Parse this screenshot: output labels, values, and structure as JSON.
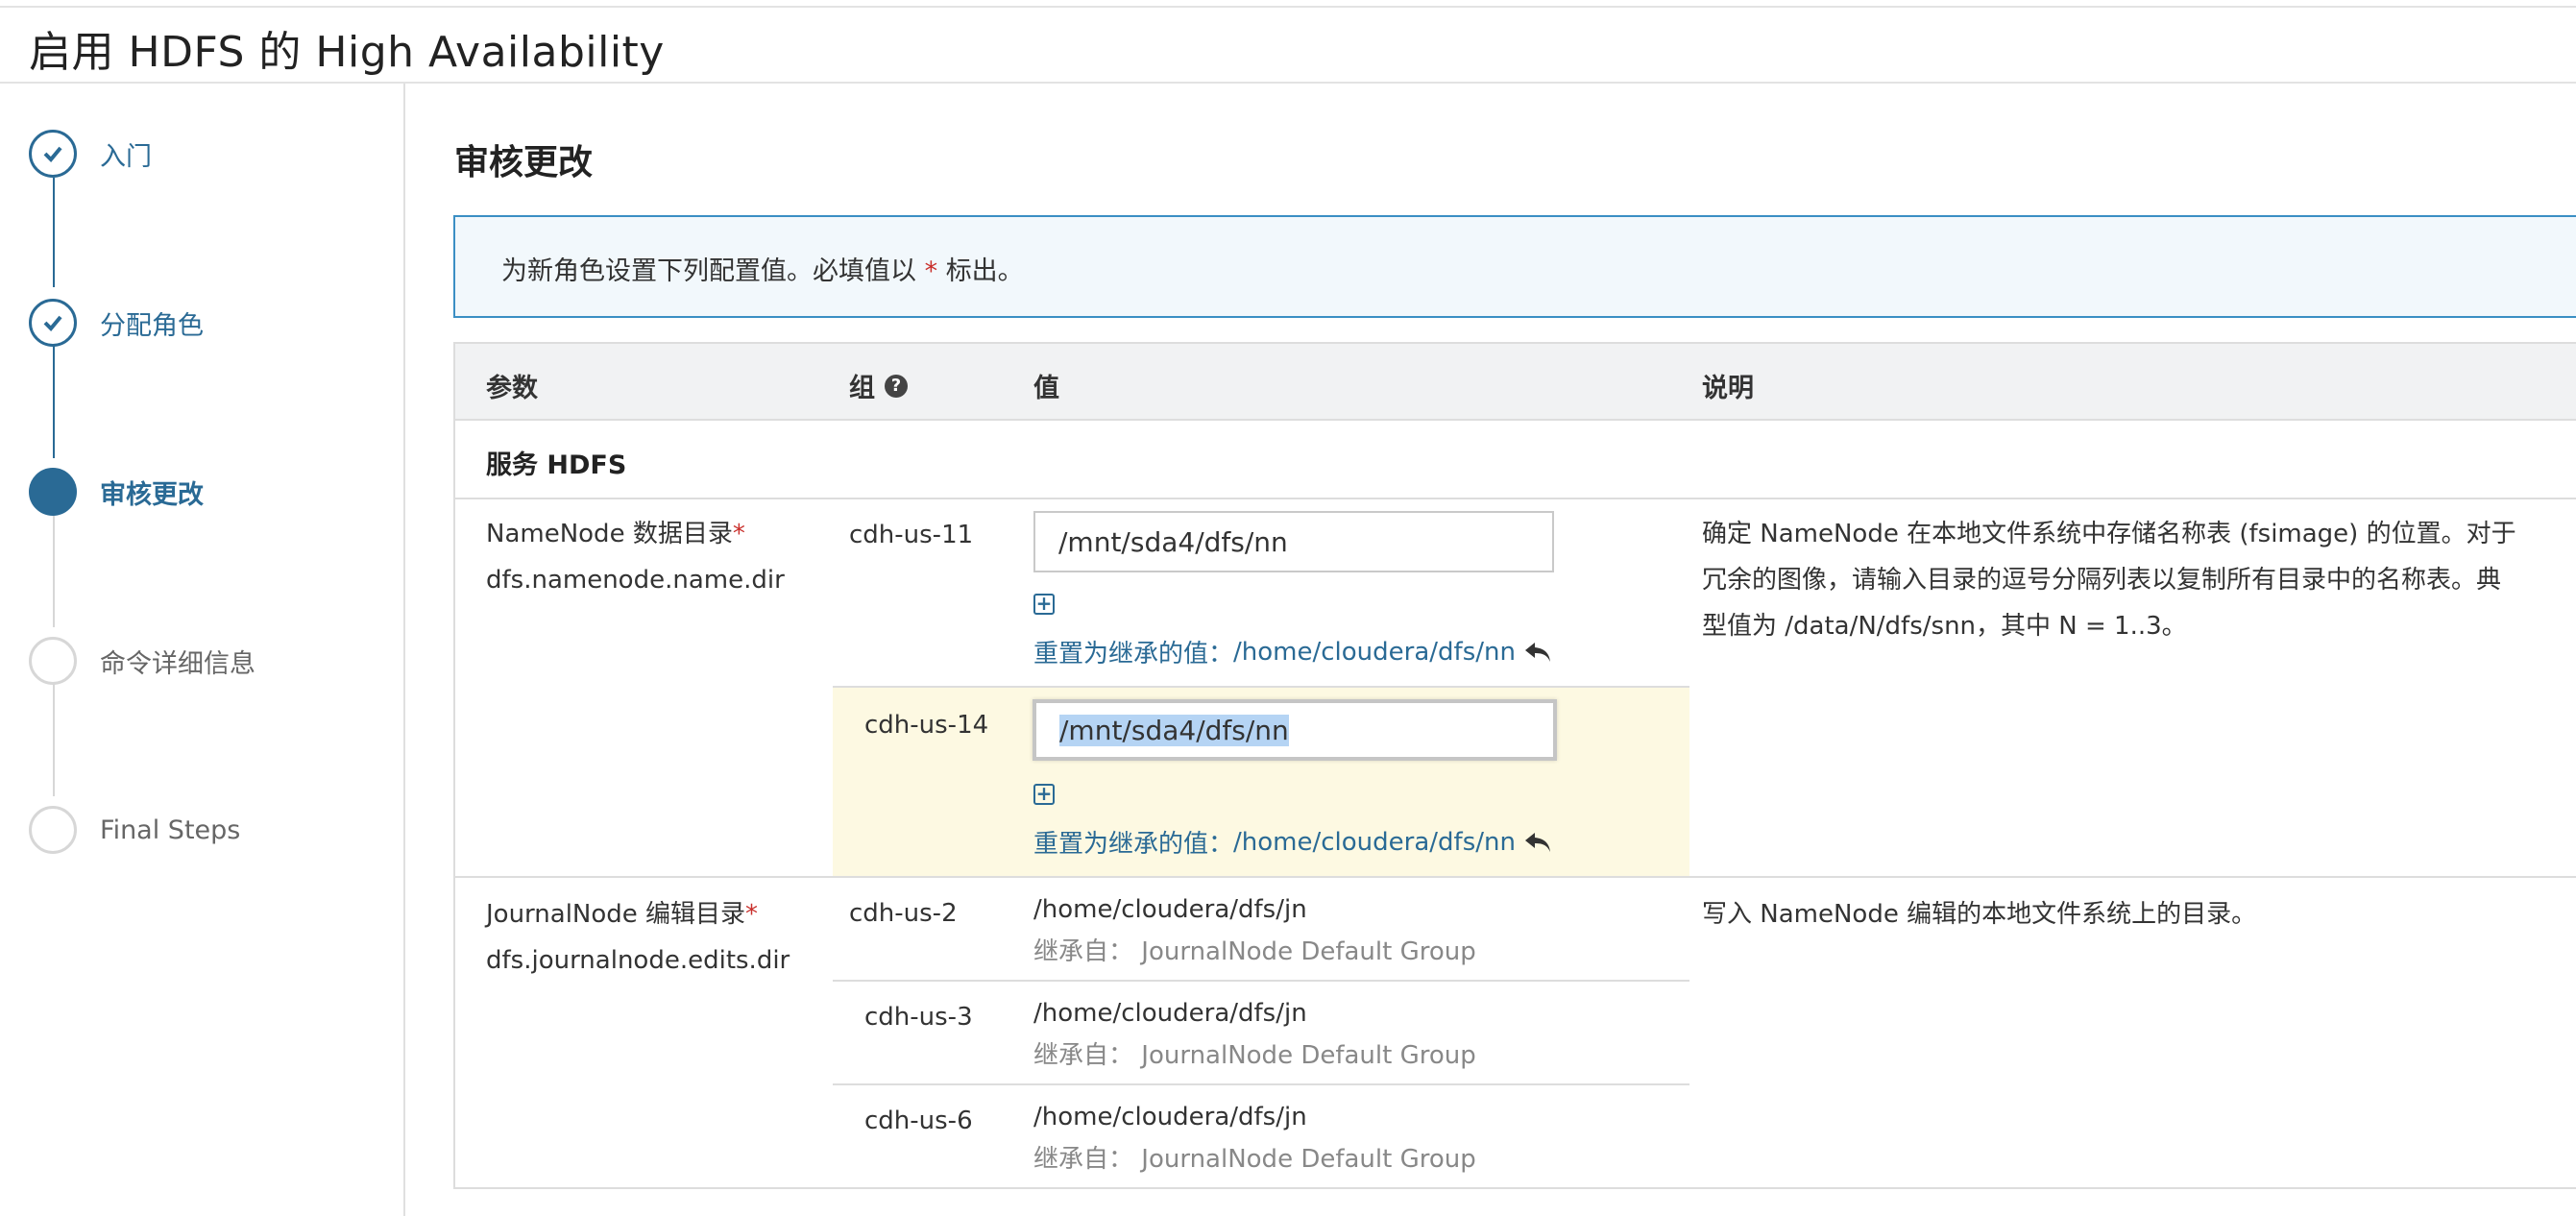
{
  "page": {
    "title": "启用 HDFS 的 High Availability"
  },
  "wizard": {
    "steps": [
      {
        "label": "入门",
        "state": "done"
      },
      {
        "label": "分配角色",
        "state": "done"
      },
      {
        "label": "审核更改",
        "state": "current"
      },
      {
        "label": "命令详细信息",
        "state": "pending"
      },
      {
        "label": "Final Steps",
        "state": "pending"
      }
    ]
  },
  "main": {
    "section_title": "审核更改",
    "info": {
      "text_before": "为新角色设置下列配置值。必填值以",
      "required_mark": "*",
      "text_after": "标出。"
    },
    "table": {
      "headers": {
        "param": "参数",
        "group": "组",
        "value": "值",
        "desc": "说明"
      },
      "service_group": "服务 HDFS",
      "namenode": {
        "label": "NameNode 数据目录",
        "required_mark": "*",
        "key": "dfs.namenode.name.dir",
        "description": [
          "确定 NameNode 在本地文件系统中存储名称表 (fsimage) 的位置。对于",
          "冗余的图像，请输入目录的逗号分隔列表以复制所有目录中的名称表。典",
          "型值为 /data/N/dfs/snn，其中 N = 1..3。"
        ],
        "rows": [
          {
            "host": "cdh-us-11",
            "value": "/mnt/sda4/dfs/nn",
            "reset_label": "重置为继承的值：",
            "reset_value": "/home/cloudera/dfs/nn"
          },
          {
            "host": "cdh-us-14",
            "value": "/mnt/sda4/dfs/nn",
            "reset_label": "重置为继承的值：",
            "reset_value": "/home/cloudera/dfs/nn"
          }
        ]
      },
      "journalnode": {
        "label": "JournalNode 编辑目录",
        "required_mark": "*",
        "key": "dfs.journalnode.edits.dir",
        "description": "写入 NameNode 编辑的本地文件系统上的目录。",
        "rows": [
          {
            "host": "cdh-us-2",
            "value": "/home/cloudera/dfs/jn",
            "inherit_label": "继承自：",
            "inherit_value": "JournalNode Default Group"
          },
          {
            "host": "cdh-us-3",
            "value": "/home/cloudera/dfs/jn",
            "inherit_label": "继承自：",
            "inherit_value": "JournalNode Default Group"
          },
          {
            "host": "cdh-us-6",
            "value": "/home/cloudera/dfs/jn",
            "inherit_label": "继承自：",
            "inherit_value": "JournalNode Default Group"
          }
        ]
      }
    }
  },
  "colors": {
    "accent": "#2a6a95",
    "required": "#c9302c",
    "highlight_row": "#fdf9e2",
    "info_bg": "#f2f8fc",
    "info_border": "#3b8fc4"
  }
}
